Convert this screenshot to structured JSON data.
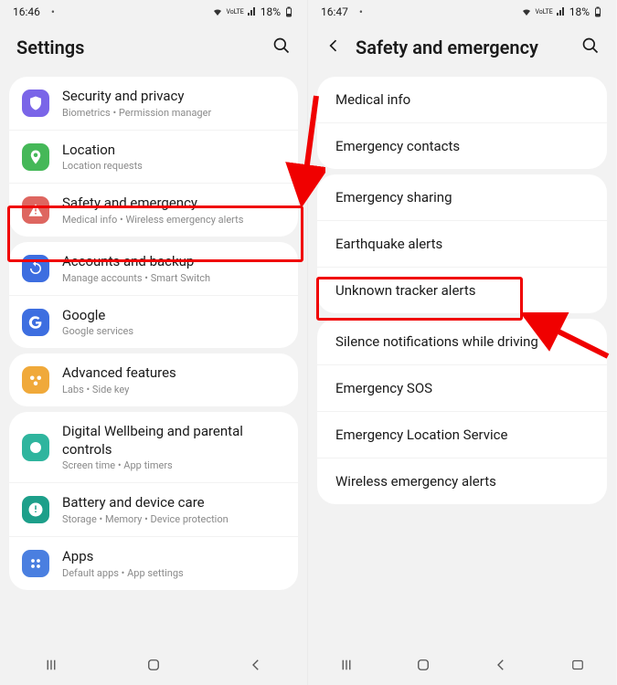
{
  "left": {
    "status": {
      "time": "16:46",
      "battery": "18%"
    },
    "header": {
      "title": "Settings"
    },
    "groups": [
      {
        "items": [
          {
            "title": "Security and privacy",
            "sub": "Biometrics  •  Permission manager",
            "iconColor": "#7a65e8"
          },
          {
            "title": "Location",
            "sub": "Location requests",
            "iconColor": "#45b858"
          },
          {
            "title": "Safety and emergency",
            "sub": "Medical info  •  Wireless emergency alerts",
            "iconColor": "#de6660"
          }
        ]
      },
      {
        "items": [
          {
            "title": "Accounts and backup",
            "sub": "Manage accounts  •  Smart Switch",
            "iconColor": "#3d6ee0"
          },
          {
            "title": "Google",
            "sub": "Google services",
            "iconColor": "#3d6ee0"
          }
        ]
      },
      {
        "items": [
          {
            "title": "Advanced features",
            "sub": "Labs  •  Side key",
            "iconColor": "#f0a93a"
          }
        ]
      },
      {
        "items": [
          {
            "title": "Digital Wellbeing and parental controls",
            "sub": "Screen time  •  App timers",
            "iconColor": "#2fb59e"
          },
          {
            "title": "Battery and device care",
            "sub": "Storage  •  Memory  •  Device protection",
            "iconColor": "#1d9f8a"
          },
          {
            "title": "Apps",
            "sub": "Default apps  •  App settings",
            "iconColor": "#4a7fe0"
          }
        ]
      }
    ]
  },
  "right": {
    "status": {
      "time": "16:47",
      "battery": "18%"
    },
    "header": {
      "title": "Safety and emergency"
    },
    "groups": [
      {
        "items": [
          "Medical info",
          "Emergency contacts"
        ]
      },
      {
        "items": [
          "Emergency sharing",
          "Earthquake alerts",
          "Unknown tracker alerts"
        ]
      },
      {
        "items": [
          "Silence notifications while driving",
          "Emergency SOS",
          "Emergency Location Service",
          "Wireless emergency alerts"
        ]
      }
    ]
  }
}
